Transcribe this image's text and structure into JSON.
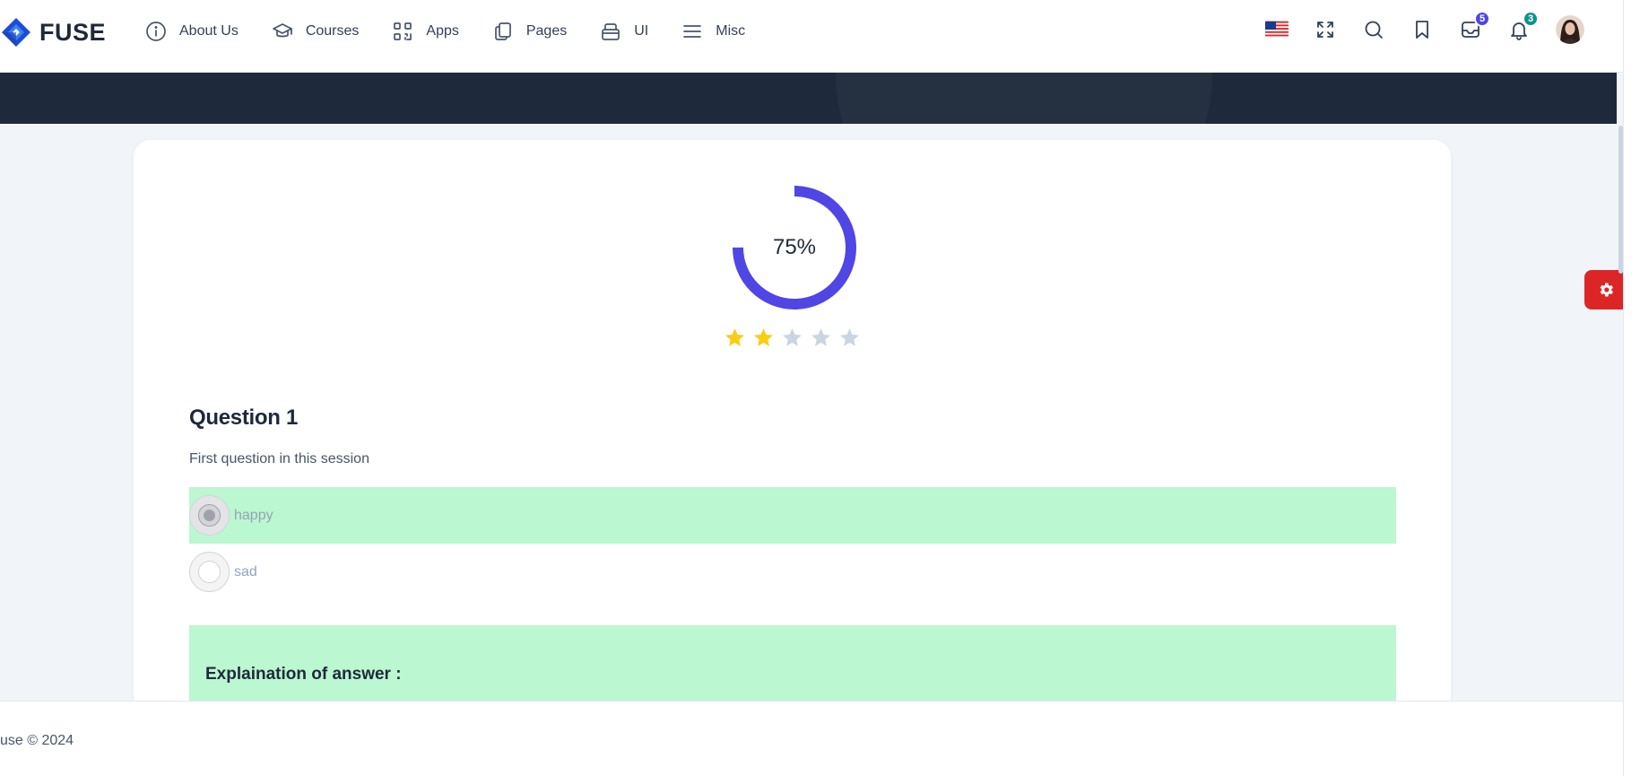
{
  "brand": {
    "name": "FUSE",
    "accent": "#4f46e5"
  },
  "nav": [
    {
      "label": "About Us",
      "icon": "info-circle-icon"
    },
    {
      "label": "Courses",
      "icon": "graduation-cap-icon"
    },
    {
      "label": "Apps",
      "icon": "qr-grid-icon"
    },
    {
      "label": "Pages",
      "icon": "copy-pages-icon"
    },
    {
      "label": "UI",
      "icon": "layers-box-icon"
    },
    {
      "label": "Misc",
      "icon": "menu-lines-icon"
    }
  ],
  "actions": {
    "language_icon": "us-flag-icon",
    "messages_count": "5",
    "notifications_count": "3",
    "messages_badge_color": "#4f46e5",
    "notifications_badge_color": "#0d9488"
  },
  "result": {
    "score_percent": 75,
    "score_label": "75%",
    "rating": 2,
    "rating_max": 5,
    "ring_color": "#4f46e5",
    "star_filled_color": "#facc15",
    "star_empty_color": "#cbd5e1"
  },
  "question": {
    "title": "Question 1",
    "description": "First question in this session",
    "options": [
      {
        "label": "happy",
        "selected": true
      },
      {
        "label": "sad",
        "selected": false
      }
    ],
    "correct_color": "#bbf7d0",
    "explanation_title": "Explaination of answer :"
  },
  "footer": {
    "text": "use © 2024"
  },
  "settings": {
    "icon": "gear-icon",
    "color": "#dc2626"
  }
}
